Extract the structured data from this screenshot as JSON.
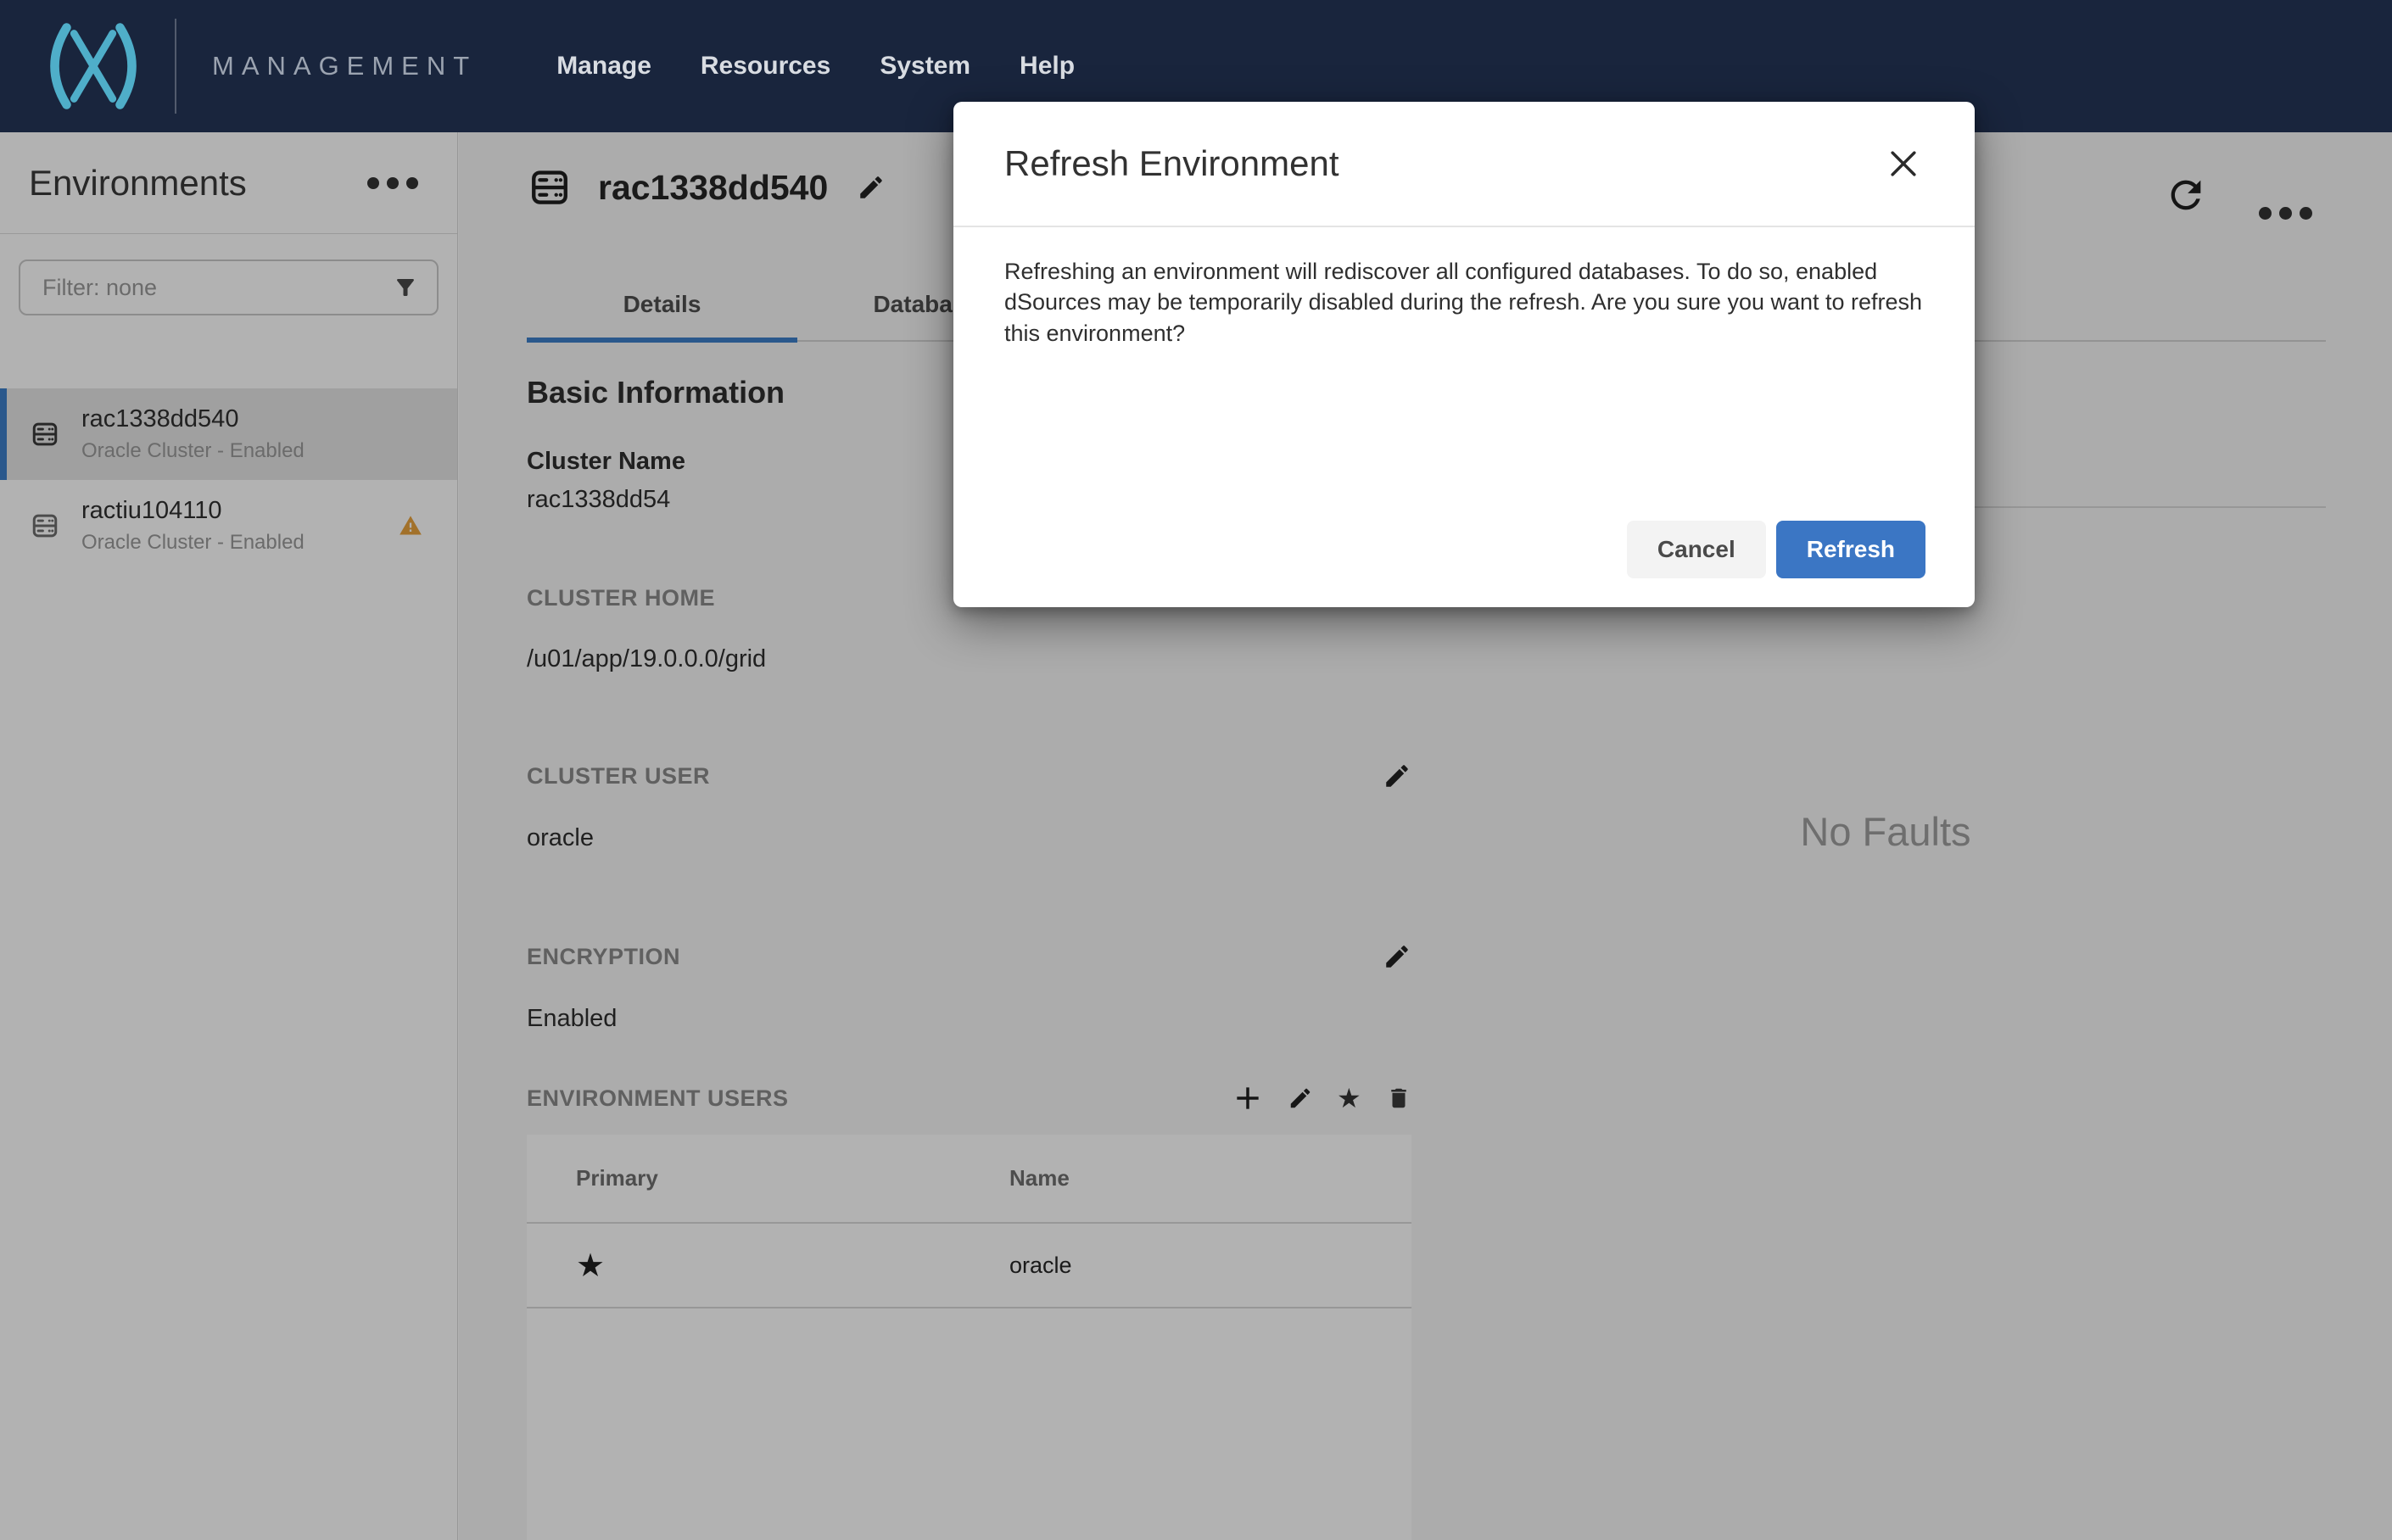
{
  "colors": {
    "nav_bg": "#19253D",
    "logo_teal": "#4FAEC9",
    "accent_blue": "#3B76C4",
    "tab_underline_blue": "#3D7FC9",
    "warning_orange": "#E8A33D"
  },
  "nav": {
    "brand": "MANAGEMENT",
    "items": [
      "Manage",
      "Resources",
      "System",
      "Help"
    ]
  },
  "sidebar": {
    "title": "Environments",
    "filter_placeholder": "Filter: none",
    "items": [
      {
        "name": "rac1338dd540",
        "status": "Oracle Cluster - Enabled",
        "selected": true
      },
      {
        "name": "ractiu104110",
        "status": "Oracle Cluster - Enabled",
        "warning": true
      }
    ]
  },
  "main": {
    "title": "rac1338dd540",
    "tabs": [
      {
        "label": "Details"
      },
      {
        "label": "Databases"
      }
    ],
    "basic_info": {
      "heading": "Basic Information",
      "cluster_name_label": "Cluster Name",
      "cluster_name_value": "rac1338dd54",
      "cluster_home_label": "CLUSTER HOME",
      "cluster_home_value": "/u01/app/19.0.0.0/grid",
      "cluster_user_label": "CLUSTER USER",
      "cluster_user_value": "oracle",
      "encryption_label": "ENCRYPTION",
      "encryption_value": "Enabled"
    },
    "environment_users": {
      "heading": "ENVIRONMENT USERS",
      "table": {
        "headers": [
          "Primary",
          "Name"
        ],
        "rows": [
          {
            "primary": "★",
            "name": "oracle"
          }
        ]
      }
    },
    "faults": {
      "empty_text": "No Faults"
    }
  },
  "modal": {
    "title": "Refresh Environment",
    "body": "Refreshing an environment will rediscover all configured databases. To do so, enabled dSources may be temporarily disabled during the refresh. Are you sure you want to refresh this environment?",
    "cancel_label": "Cancel",
    "confirm_label": "Refresh"
  }
}
